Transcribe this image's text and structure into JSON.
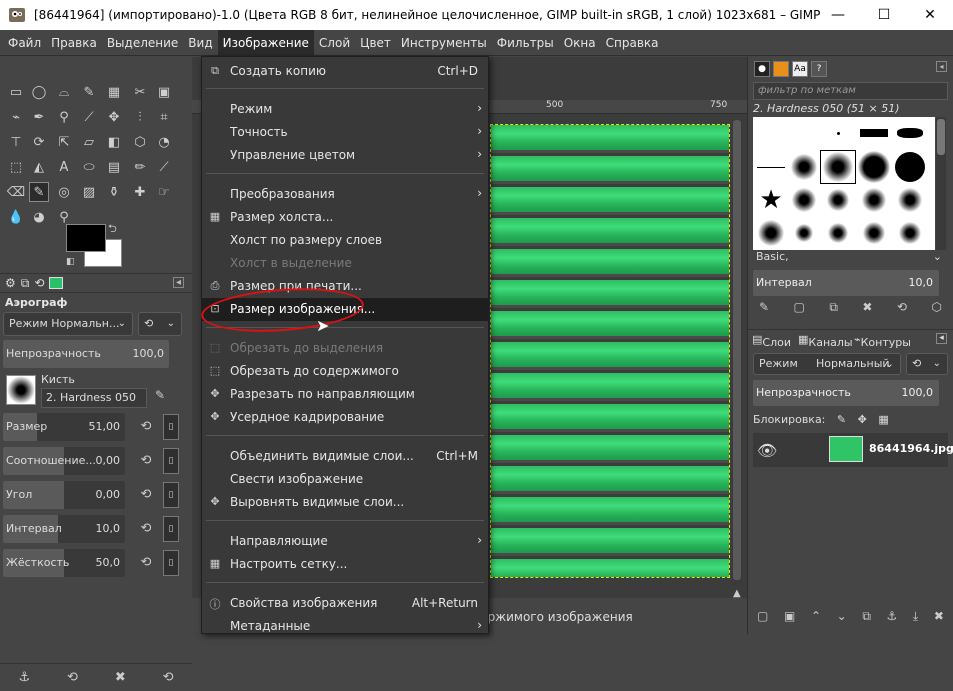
{
  "window": {
    "title": "[86441964] (импортировано)-1.0 (Цвета RGB 8 бит, нелинейное целочисленное, GIMP built-in sRGB, 1 слой) 1023x681 – GIMP",
    "minimize": "—",
    "maximize": "☐",
    "close": "✕"
  },
  "menubar": [
    "Файл",
    "Правка",
    "Выделение",
    "Вид",
    "Изображение",
    "Слой",
    "Цвет",
    "Инструменты",
    "Фильтры",
    "Окна",
    "Справка"
  ],
  "menu": {
    "items": [
      {
        "icon": "⧉",
        "label": "Создать копию",
        "shortcut": "Ctrl+D"
      },
      {
        "label": "Режим",
        "sub": "›"
      },
      {
        "label": "Точность",
        "sub": "›"
      },
      {
        "label": "Управление цветом",
        "sub": "›"
      },
      {
        "label": "Преобразования",
        "sub": "›"
      },
      {
        "icon": "▦",
        "label": "Размер холста..."
      },
      {
        "label": "Холст по размеру слоев"
      },
      {
        "label": "Холст в выделение"
      },
      {
        "icon": "⎙",
        "label": "Размер при печати..."
      },
      {
        "icon": "⊡",
        "label": "Размер изображения..."
      },
      {
        "icon": "⬚",
        "label": "Обрезать до выделения"
      },
      {
        "icon": "⬚",
        "label": "Обрезать до содержимого"
      },
      {
        "icon": "✥",
        "label": "Разрезать по направляющим"
      },
      {
        "icon": "✥",
        "label": "Усердное кадрирование"
      },
      {
        "label": "Объединить видимые слои...",
        "shortcut": "Ctrl+M"
      },
      {
        "label": "Свести изображение"
      },
      {
        "icon": "✥",
        "label": "Выровнять видимые слои..."
      },
      {
        "label": "Направляющие",
        "sub": "›"
      },
      {
        "icon": "▦",
        "label": "Настроить сетку..."
      },
      {
        "icon": "ⓘ",
        "label": "Свойства изображения",
        "shortcut": "Alt+Return"
      },
      {
        "label": "Метаданные",
        "sub": "›"
      }
    ]
  },
  "ruler": {
    "t500": "500",
    "t750": "750"
  },
  "status": {
    "text": "держимого изображения"
  },
  "toolopts": {
    "title": "Аэрограф",
    "mode_label": "Режим Нормальн...",
    "opacity_label": "Непрозрачность",
    "opacity_value": "100,0",
    "brush_label": "Кисть",
    "brush_name": "2. Hardness 050",
    "size_label": "Размер",
    "size_value": "51,00",
    "ratio_label": "Соотношение...",
    "ratio_value": "0,00",
    "angle_label": "Угол",
    "angle_value": "0,00",
    "interval_label": "Интервал",
    "interval_value": "10,0",
    "hard_label": "Жёсткость",
    "hard_value": "50,0"
  },
  "rdock": {
    "filter_placeholder": "фильтр по меткам",
    "brush_title": "2. Hardness 050 (51 × 51)",
    "basic": "Basic,",
    "interval_label": "Интервал",
    "interval_value": "10,0",
    "tab_layers": "Слои",
    "tab_channels": "Каналы",
    "tab_paths": "Контуры",
    "mode_label": "Режим",
    "mode_value": "Нормальный",
    "opacity_label": "Непрозрачность",
    "opacity_value": "100,0",
    "lock_label": "Блокировка:",
    "layer_name": "86441964.jpg"
  },
  "colors": {
    "accent_green": "#2fc466",
    "annotation_red": "#d11111",
    "menu_bg": "#393939"
  }
}
